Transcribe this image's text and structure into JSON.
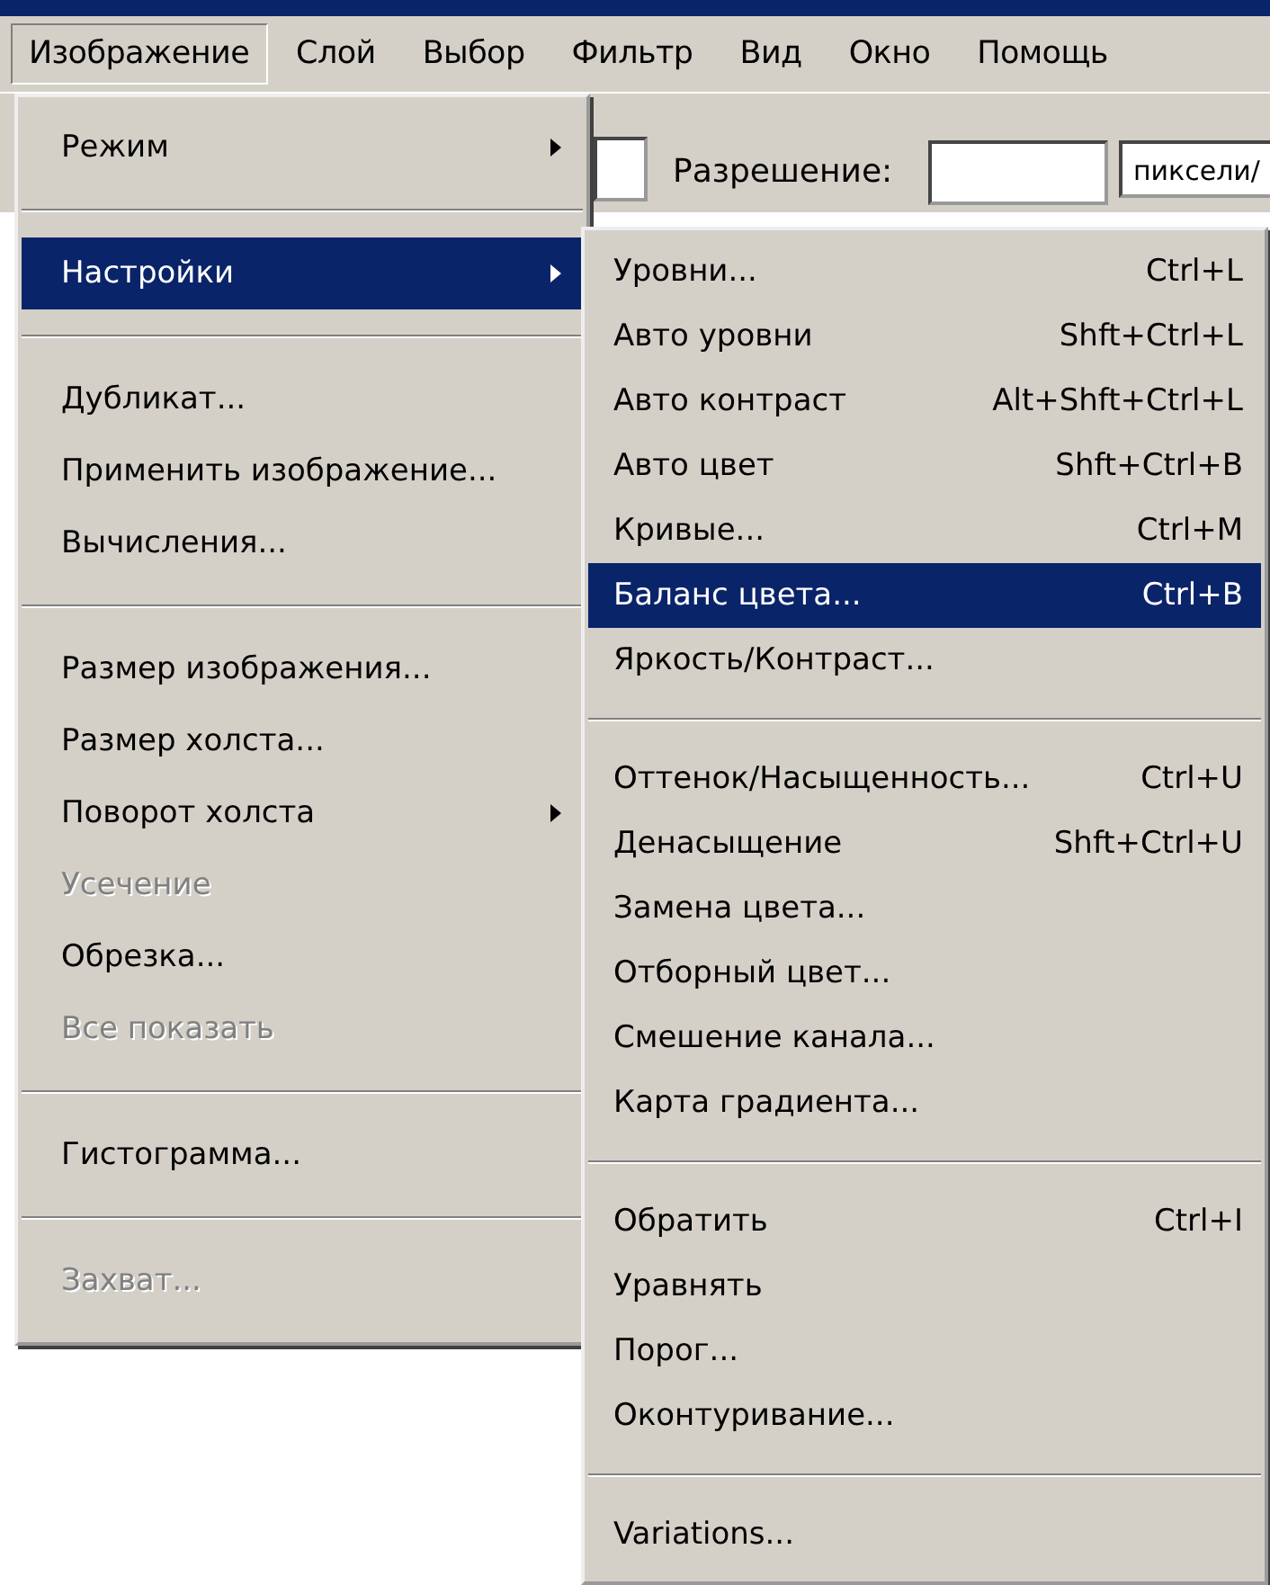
{
  "menubar": [
    {
      "label": "Изображение",
      "selected": true
    },
    {
      "label": "Слой",
      "selected": false
    },
    {
      "label": "Выбор",
      "selected": false
    },
    {
      "label": "Фильтр",
      "selected": false
    },
    {
      "label": "Вид",
      "selected": false
    },
    {
      "label": "Окно",
      "selected": false
    },
    {
      "label": "Помощь",
      "selected": false
    }
  ],
  "options_bar": {
    "resolution_label": "Разрешение:",
    "unit": "пиксели/"
  },
  "image_menu": [
    {
      "kind": "command",
      "label": "Режим",
      "has_submenu": true,
      "disabled": false,
      "selected": false
    },
    {
      "kind": "separator"
    },
    {
      "kind": "command",
      "label": "Настройки",
      "has_submenu": true,
      "disabled": false,
      "selected": true
    },
    {
      "kind": "separator"
    },
    {
      "kind": "command",
      "label": "Дубликат...",
      "has_submenu": false,
      "disabled": false,
      "selected": false
    },
    {
      "kind": "command",
      "label": "Применить изображение...",
      "has_submenu": false,
      "disabled": false,
      "selected": false
    },
    {
      "kind": "command",
      "label": "Вычисления...",
      "has_submenu": false,
      "disabled": false,
      "selected": false
    },
    {
      "kind": "separator"
    },
    {
      "kind": "command",
      "label": "Размер изображения...",
      "has_submenu": false,
      "disabled": false,
      "selected": false
    },
    {
      "kind": "command",
      "label": "Размер холста...",
      "has_submenu": false,
      "disabled": false,
      "selected": false
    },
    {
      "kind": "command",
      "label": "Поворот холста",
      "has_submenu": true,
      "disabled": false,
      "selected": false
    },
    {
      "kind": "command",
      "label": "Усечение",
      "has_submenu": false,
      "disabled": true,
      "selected": false
    },
    {
      "kind": "command",
      "label": "Обрезка...",
      "has_submenu": false,
      "disabled": false,
      "selected": false
    },
    {
      "kind": "command",
      "label": "Все показать",
      "has_submenu": false,
      "disabled": true,
      "selected": false
    },
    {
      "kind": "separator"
    },
    {
      "kind": "command",
      "label": "Гистограмма...",
      "has_submenu": false,
      "disabled": false,
      "selected": false
    },
    {
      "kind": "separator"
    },
    {
      "kind": "command",
      "label": "Захват...",
      "has_submenu": false,
      "disabled": true,
      "selected": false
    }
  ],
  "adjustments_menu": [
    {
      "kind": "command",
      "label": "Уровни...",
      "shortcut": "Ctrl+L",
      "selected": false
    },
    {
      "kind": "command",
      "label": "Авто уровни",
      "shortcut": "Shft+Ctrl+L",
      "selected": false
    },
    {
      "kind": "command",
      "label": "Авто контраст",
      "shortcut": "Alt+Shft+Ctrl+L",
      "selected": false
    },
    {
      "kind": "command",
      "label": "Авто цвет",
      "shortcut": "Shft+Ctrl+B",
      "selected": false
    },
    {
      "kind": "command",
      "label": "Кривые...",
      "shortcut": "Ctrl+M",
      "selected": false
    },
    {
      "kind": "command",
      "label": "Баланс цвета...",
      "shortcut": "Ctrl+B",
      "selected": true
    },
    {
      "kind": "command",
      "label": "Яркость/Контраст...",
      "selected": false
    },
    {
      "kind": "separator"
    },
    {
      "kind": "command",
      "label": "Оттенок/Насыщенность...",
      "shortcut": "Ctrl+U",
      "selected": false
    },
    {
      "kind": "command",
      "label": "Денасыщение",
      "shortcut": "Shft+Ctrl+U",
      "selected": false
    },
    {
      "kind": "command",
      "label": "Замена цвета...",
      "selected": false
    },
    {
      "kind": "command",
      "label": "Отборный цвет...",
      "selected": false
    },
    {
      "kind": "command",
      "label": "Смешение канала...",
      "selected": false
    },
    {
      "kind": "command",
      "label": "Карта градиента...",
      "selected": false
    },
    {
      "kind": "separator"
    },
    {
      "kind": "command",
      "label": "Обратить",
      "shortcut": "Ctrl+I",
      "selected": false
    },
    {
      "kind": "command",
      "label": "Уравнять",
      "selected": false
    },
    {
      "kind": "command",
      "label": "Порог...",
      "selected": false
    },
    {
      "kind": "command",
      "label": "Оконтуривание...",
      "selected": false
    },
    {
      "kind": "separator"
    },
    {
      "kind": "command",
      "label": "Variations...",
      "selected": false
    }
  ]
}
